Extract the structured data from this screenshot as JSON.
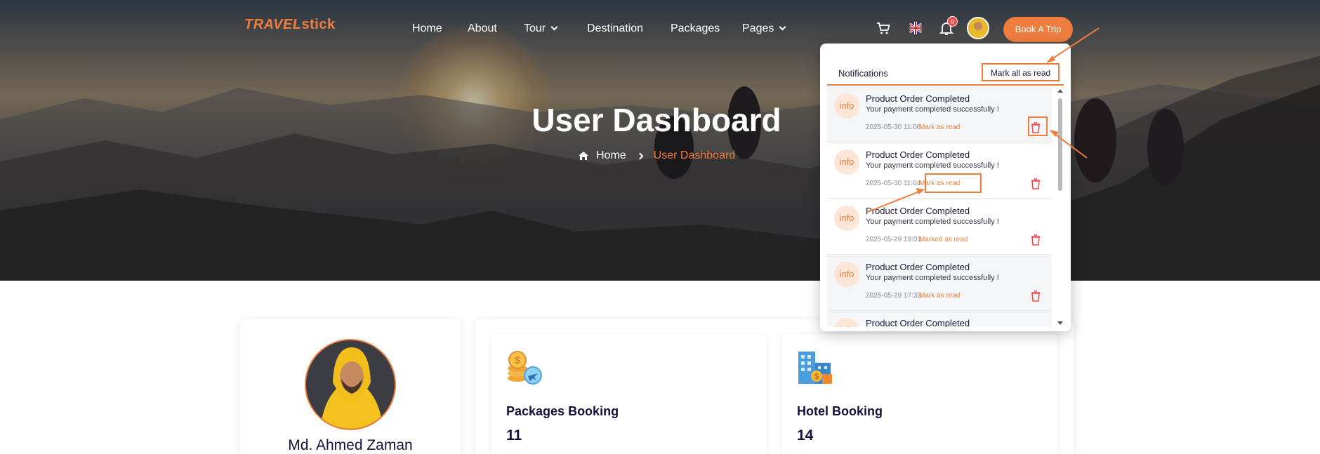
{
  "brand": {
    "logo_part1": "TRAVEL",
    "logo_part2": "stick"
  },
  "nav": {
    "items": [
      {
        "label": "Home"
      },
      {
        "label": "About"
      },
      {
        "label": "Tour"
      },
      {
        "label": "Destination"
      },
      {
        "label": "Packages"
      },
      {
        "label": "Pages"
      }
    ],
    "notification_count": "9",
    "cta_label": "Book A Trip"
  },
  "hero": {
    "title": "User Dashboard",
    "breadcrumb_home": "Home",
    "breadcrumb_current": "User Dashboard"
  },
  "notifications": {
    "title": "Notifications",
    "mark_all_label": "Mark all as read",
    "items": [
      {
        "icon_text": "info",
        "title": "Product Order Completed",
        "message": "Your payment completed successfully !",
        "time": "2025-05-30 11:06",
        "action": "Mark as read"
      },
      {
        "icon_text": "info",
        "title": "Product Order Completed",
        "message": "Your payment completed successfully !",
        "time": "2025-05-30 11:04",
        "action": "Mark as read"
      },
      {
        "icon_text": "info",
        "title": "Product Order Completed",
        "message": "Your payment completed successfully !",
        "time": "2025-05-29 18:01",
        "action": "Marked as read"
      },
      {
        "icon_text": "info",
        "title": "Product Order Completed",
        "message": "Your payment completed successfully !",
        "time": "2025-05-29 17:32",
        "action": "Mark as read"
      },
      {
        "icon_text": "info",
        "title": "Product Order Completed",
        "message": "",
        "time": "",
        "action": ""
      }
    ]
  },
  "profile": {
    "name": "Md. Ahmed Zaman"
  },
  "stats": [
    {
      "title": "Packages Booking",
      "value": "11"
    },
    {
      "title": "Hotel Booking",
      "value": "14"
    }
  ],
  "colors": {
    "accent": "#ef7e3e",
    "danger": "#f24c4c",
    "heading": "#12123a"
  }
}
